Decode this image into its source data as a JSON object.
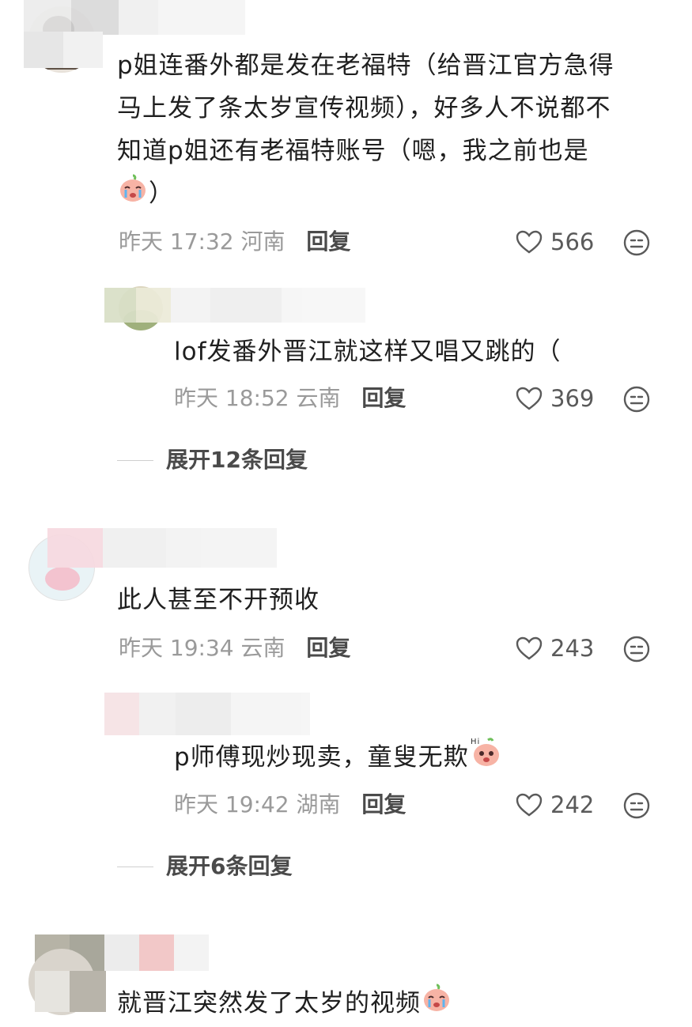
{
  "comments": [
    {
      "text_lines": [
        "p姐连番外都是发在老福特（给晋江官方急得",
        "马上发了条太岁宣传视频），好多人不说都不",
        "知道p姐还有老福特账号（嗯，我之前也是"
      ],
      "text_tail": "）",
      "time": "昨天 17:32",
      "location": "河南",
      "reply_label": "回复",
      "likes": "566"
    },
    {
      "text": "lof发番外晋江就这样又唱又跳的（",
      "time": "昨天 18:52",
      "location": "云南",
      "reply_label": "回复",
      "likes": "369"
    },
    {
      "expand_label": "展开12条回复"
    },
    {
      "text": "此人甚至不开预收",
      "time": "昨天 19:34",
      "location": "云南",
      "reply_label": "回复",
      "likes": "243"
    },
    {
      "text": "p师傅现炒现卖，童叟无欺",
      "time": "昨天 19:42",
      "location": "湖南",
      "reply_label": "回复",
      "likes": "242"
    },
    {
      "expand_label": "展开6条回复"
    },
    {
      "text": "就晋江突然发了太岁的视频"
    }
  ],
  "icons": {
    "like": "heart-outline-icon",
    "comment_emoji": "face-neutral-icon",
    "sticker_cry": "crying-peach-sticker",
    "sticker_hi": "hi-peach-sticker"
  },
  "colors": {
    "meta": "#9a9a9a",
    "text": "#1f1f1f",
    "sticker": "#f49a8c"
  }
}
